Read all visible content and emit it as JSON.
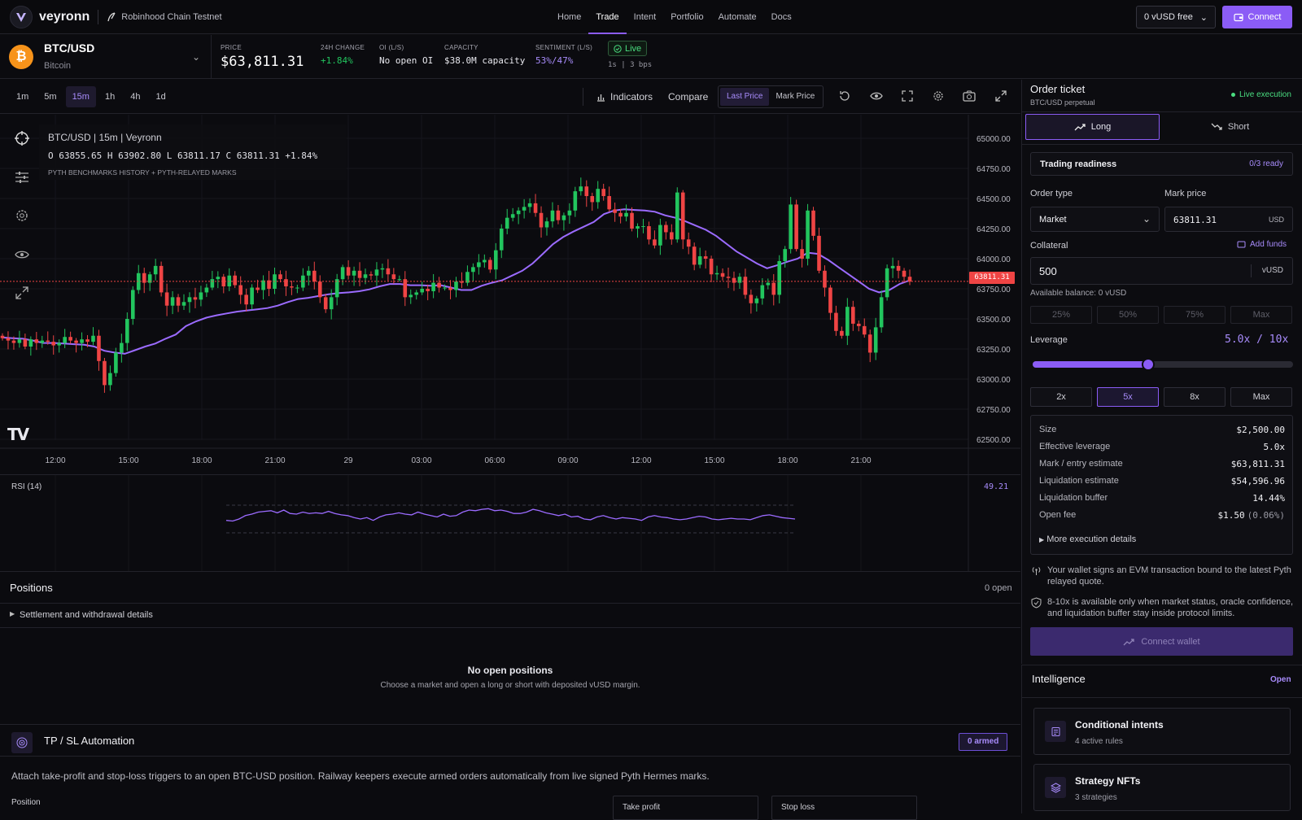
{
  "header": {
    "brand": "veyronn",
    "network": "Robinhood Chain Testnet",
    "nav": [
      "Home",
      "Trade",
      "Intent",
      "Portfolio",
      "Automate",
      "Docs"
    ],
    "active_nav": "Trade",
    "wallet_select": "0  vUSD free",
    "connect_label": "Connect"
  },
  "market": {
    "pair": "BTC/USD",
    "asset_name": "Bitcoin",
    "price_label": "PRICE",
    "price": "$63,811.31",
    "change_label": "24H CHANGE",
    "change": "+1.84%",
    "oi_label": "OI (L/S)",
    "oi": "No open OI",
    "capacity_label": "CAPACITY",
    "capacity": "$38.0M capacity",
    "sentiment_label": "SENTIMENT (L/S)",
    "sentiment": "53%/47%",
    "live_label": "Live",
    "live_sub": "1s | 3 bps"
  },
  "toolbar": {
    "timeframes": [
      "1m",
      "5m",
      "15m",
      "1h",
      "4h",
      "1d"
    ],
    "active_timeframe": "15m",
    "indicators_label": "Indicators",
    "compare_label": "Compare",
    "last_price_label": "Last Price",
    "mark_price_label": "Mark Price"
  },
  "chart_overlay": {
    "title": "BTC/USD | 15m | Veyronn",
    "ohlc": "O 63855.65 H 63902.80 L 63811.17 C 63811.31 +1.84%",
    "source": "PYTH BENCHMARKS HISTORY + PYTH-RELAYED MARKS",
    "last_price_tag": "63811.31",
    "watermark": "TV"
  },
  "chart_data": [
    {
      "type": "candlestick",
      "title": "BTC/USD | 15m | Veyronn",
      "x_ticks": [
        "12:00",
        "15:00",
        "18:00",
        "21:00",
        "29",
        "03:00",
        "06:00",
        "09:00",
        "12:00",
        "15:00",
        "18:00",
        "21:00"
      ],
      "y_ticks": [
        "65000.00",
        "64750.00",
        "64500.00",
        "64250.00",
        "64000.00",
        "63750.00",
        "63500.00",
        "63250.00",
        "63000.00",
        "62750.00",
        "62500.00"
      ],
      "ylim": [
        62500,
        65000
      ],
      "last_price": 63811.31,
      "close_path": [
        63340,
        63320,
        63300,
        63330,
        63270,
        63330,
        63300,
        63320,
        63310,
        63280,
        63300,
        63350,
        63320,
        63300,
        63330,
        63310,
        63360,
        63150,
        62950,
        63050,
        63220,
        63300,
        63500,
        63740,
        63880,
        63800,
        63870,
        63940,
        63720,
        63610,
        63680,
        63610,
        63640,
        63680,
        63660,
        63720,
        63760,
        63830,
        63850,
        63770,
        63860,
        63780,
        63700,
        63620,
        63760,
        63740,
        63820,
        63750,
        63870,
        63830,
        63770,
        63760,
        63760,
        63860,
        63900,
        63810,
        63680,
        63580,
        63680,
        63830,
        63930,
        63860,
        63900,
        63840,
        63870,
        63860,
        63910,
        63920,
        63870,
        63830,
        63830,
        63680,
        63700,
        63720,
        63750,
        63730,
        63800,
        63760,
        63760,
        63740,
        63810,
        63800,
        63890,
        63930,
        63970,
        63990,
        63910,
        64070,
        64250,
        64340,
        64370,
        64400,
        64430,
        64460,
        64380,
        64260,
        64310,
        64400,
        64320,
        64360,
        64400,
        64560,
        64600,
        64520,
        64470,
        64580,
        64520,
        64410,
        64380,
        64350,
        64380,
        64250,
        64270,
        64270,
        64160,
        64110,
        64280,
        64220,
        64160,
        64550,
        64160,
        64100,
        63950,
        64020,
        64000,
        63870,
        63880,
        63850,
        63840,
        63800,
        63850,
        63700,
        63630,
        63670,
        63780,
        63800,
        63700,
        63980,
        64080,
        64450,
        64080,
        64000,
        64400,
        64190,
        63900,
        63760,
        63550,
        63400,
        63360,
        63600,
        63460,
        63440,
        63370,
        63220,
        63430,
        63680,
        63920,
        63940,
        63900,
        63850,
        63810
      ],
      "series": [
        {
          "name": "",
          "kind": "moving-average",
          "values": [
            63345,
            63340,
            63335,
            63320,
            63300,
            63300,
            63295,
            63290,
            63285,
            63270,
            63235,
            63220,
            63210,
            63240,
            63270,
            63295,
            63335,
            63370,
            63440,
            63480,
            63510,
            63530,
            63545,
            63560,
            63570,
            63580,
            63590,
            63610,
            63640,
            63665,
            63675,
            63690,
            63705,
            63715,
            63720,
            63730,
            63745,
            63770,
            63790,
            63790,
            63780,
            63780,
            63775,
            63780,
            63760,
            63740,
            63740,
            63775,
            63800,
            63820,
            63860,
            63900,
            63960,
            64040,
            64120,
            64180,
            64225,
            64265,
            64305,
            64370,
            64400,
            64410,
            64405,
            64400,
            64390,
            64360,
            64340,
            64310,
            64275,
            64240,
            64190,
            64125,
            64060,
            64010,
            63960,
            63920,
            63945,
            63975,
            64000,
            64050,
            64040,
            63990,
            63930,
            63870,
            63810,
            63750,
            63720,
            63740,
            63790,
            63820
          ]
        }
      ]
    },
    {
      "type": "line",
      "title": "RSI (14)",
      "last_value": 49.21,
      "ylim": [
        0,
        100
      ],
      "bands": [
        30,
        70
      ],
      "values": [
        48,
        47,
        50,
        55,
        57,
        60,
        61,
        62,
        59,
        63,
        58,
        57,
        60,
        58,
        59,
        58,
        61,
        58,
        56,
        55,
        52,
        50,
        52,
        48,
        53,
        56,
        57,
        59,
        57,
        56,
        60,
        57,
        55,
        53,
        57,
        54,
        55,
        60,
        63,
        62,
        64,
        65,
        62,
        63,
        61,
        58,
        58,
        60,
        64,
        62,
        59,
        57,
        55,
        57,
        53,
        54,
        50,
        49,
        53,
        55,
        52,
        50,
        52,
        51,
        50,
        48,
        53,
        55,
        53,
        52,
        50,
        49,
        50,
        52,
        54,
        53,
        50,
        49,
        50,
        51,
        50,
        50,
        49,
        52,
        55,
        56,
        54,
        52,
        51,
        50
      ]
    }
  ],
  "rsi": {
    "label": "RSI (14)",
    "value": "49.21"
  },
  "positions": {
    "title": "Positions",
    "count": "0 open",
    "settlement_label": "Settlement and withdrawal details",
    "empty_title": "No open positions",
    "empty_sub": "Choose a market and open a long or short with deposited vUSD margin."
  },
  "tpsl": {
    "title": "TP / SL Automation",
    "badge": "0 armed",
    "description": "Attach take-profit and stop-loss triggers to an open BTC-USD position. Railway keepers execute armed orders automatically from live signed Pyth Hermes marks.",
    "position_label": "Position",
    "take_profit_label": "Take profit",
    "stop_loss_label": "Stop loss"
  },
  "ticket": {
    "title": "Order ticket",
    "subtitle": "BTC/USD perpetual",
    "live_exec": "Live execution",
    "long_label": "Long",
    "short_label": "Short",
    "readiness_label": "Trading readiness",
    "readiness_value": "0/3 ready",
    "order_type_label": "Order type",
    "order_type_value": "Market",
    "mark_price_label": "Mark price",
    "mark_price_value": "63811.31",
    "mark_price_unit": "USD",
    "collateral_label": "Collateral",
    "add_funds_label": "Add funds",
    "collateral_value": "500",
    "collateral_unit": "vUSD",
    "available_balance": "Available balance: 0 vUSD",
    "pct_buttons": [
      "25%",
      "50%",
      "75%",
      "Max"
    ],
    "leverage_label": "Leverage",
    "leverage_value": "5.0x / 10x",
    "leverage_fraction": 0.444,
    "leverage_buttons": [
      "2x",
      "5x",
      "8x",
      "Max"
    ],
    "active_leverage": "5x",
    "summary": [
      {
        "k": "Size",
        "v": "$2,500.00"
      },
      {
        "k": "Effective leverage",
        "v": "5.0x"
      },
      {
        "k": "Mark / entry estimate",
        "v": "$63,811.31"
      },
      {
        "k": "Liquidation estimate",
        "v": "$54,596.96"
      },
      {
        "k": "Liquidation buffer",
        "v": "14.44%"
      },
      {
        "k": "Open fee",
        "v": "$1.50",
        "extra": "(0.06%)"
      }
    ],
    "more_details": "More execution details",
    "note1": "Your wallet signs an EVM transaction bound to the latest Pyth relayed quote.",
    "note2": "8-10x is available only when market status, oracle confidence, and liquidation buffer stay inside protocol limits.",
    "connect_wallet_label": "Connect wallet"
  },
  "intelligence": {
    "title": "Intelligence",
    "open_label": "Open",
    "cards": [
      {
        "title": "Conditional intents",
        "sub": "4 active rules"
      },
      {
        "title": "Strategy NFTs",
        "sub": "3 strategies"
      }
    ]
  },
  "colors": {
    "accent": "#8b5cf6",
    "up": "#22c55e",
    "down": "#ef4444",
    "bg": "#0b0b0f"
  }
}
